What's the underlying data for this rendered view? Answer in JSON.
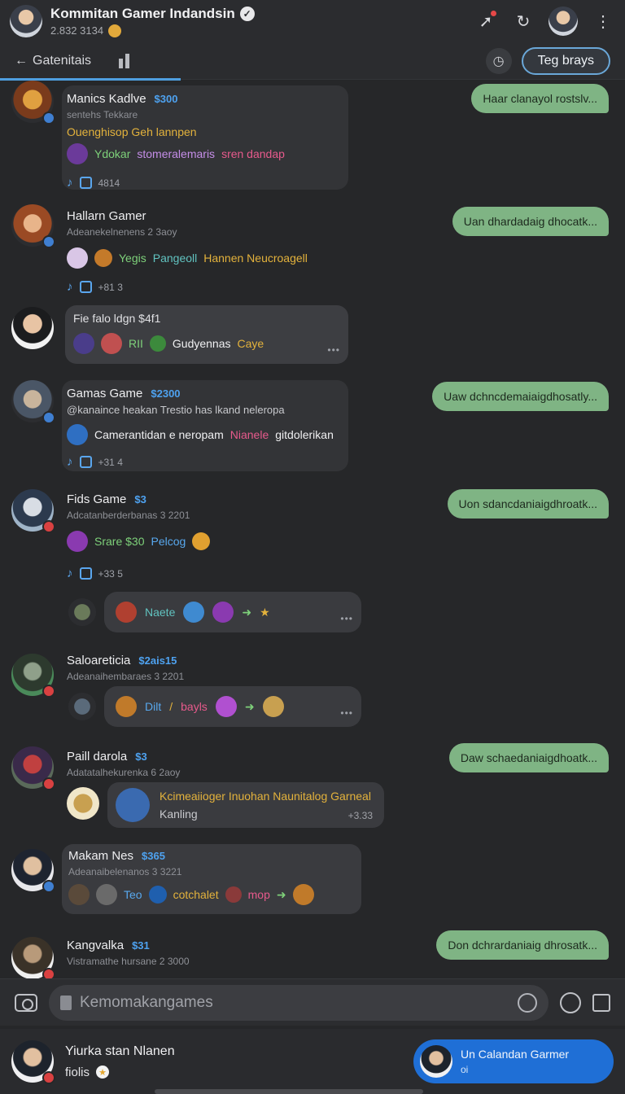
{
  "header": {
    "title": "Kommitan Gamer Indandsin",
    "subtitle": "2.832 3134",
    "icons": [
      "verified-icon",
      "share-icon",
      "refresh-icon",
      "more-icon"
    ]
  },
  "subbar": {
    "back_label": "Gatenitais",
    "pill_label": "Teg brays"
  },
  "messages": [
    {
      "name": "Manics Kadlve",
      "price": "$300",
      "sub": "sentehs Tekkare",
      "line1": "Ouenghisop Geh lannpen",
      "line2_a": "Ydokar",
      "line2_b": "stomeralemaris",
      "line2_c": "sren dandap",
      "meta": "4814",
      "reply": "Haar clanayol rostslv..."
    },
    {
      "name": "Hallarn Gamer",
      "sub": "Adeanekelnenens 2 3aoy",
      "line1_a": "Yegis",
      "line1_b": "Pangeoll",
      "line1_c": "Hannen Neucroagell",
      "meta": "+81 3",
      "reply": "Uan dhardadaig dhocatk..."
    },
    {
      "title": "Fie falo ldgn $4f1",
      "items_a": "RII",
      "items_b": "Gudyennas",
      "items_c": "Caye"
    },
    {
      "name": "Gamas Game",
      "price": "$2300",
      "sub": "@kanaince heakan Trestio has lkand neleropa",
      "line1_a": "Camerantidan e neropam",
      "line1_b": "Nianele",
      "line1_c": "gitdolerikan",
      "meta": "+31 4",
      "reply": "Uaw dchncdemaiaigdhosatly..."
    },
    {
      "name": "Fids Game",
      "price": "$3",
      "sub": "Adcatanberderbanas 3 2201",
      "line1_a": "Srare $30",
      "line1_b": "Pelcog",
      "meta": "+33 5",
      "pill_label": "Naete",
      "reply": "Uon sdancdaniaigdhroatk..."
    },
    {
      "name": "Saloareticia",
      "price": "$2ais15",
      "sub": "Adeanaihembaraes 3 2201",
      "pill_a": "Dilt",
      "pill_b": "bayls"
    },
    {
      "name": "Paill darola",
      "price": "$3",
      "sub": "Adatatalhekurenka 6 2aoy",
      "card_title": "Kcimeaiioger Inuohan Naunitalog Garneal",
      "card_sub": "Kanling",
      "card_meta": "+3.33",
      "reply": "Daw schaedaniaigdhoatk..."
    },
    {
      "name": "Makam Nes",
      "price": "$365",
      "sub": "Adeanaibelenanos 3 3221",
      "pill_a": "Teo",
      "pill_b": "cotchalet",
      "pill_c": "mop"
    },
    {
      "name": "Kangvalka",
      "price": "$31",
      "sub": "Vistramathe hursane 2 3000",
      "reply": "Don dchrardaniaig dhrosatk..."
    }
  ],
  "composer": {
    "placeholder": "Kemomakangames"
  },
  "footer": {
    "name": "Yiurka stan Nlanen",
    "sub": "fiolis",
    "pill_title": "Un Calandan Garmer",
    "pill_sub": "oi"
  },
  "colors": {
    "accent": "#4f9fe0",
    "reply_bubble": "#7fb484",
    "background": "#262729"
  }
}
